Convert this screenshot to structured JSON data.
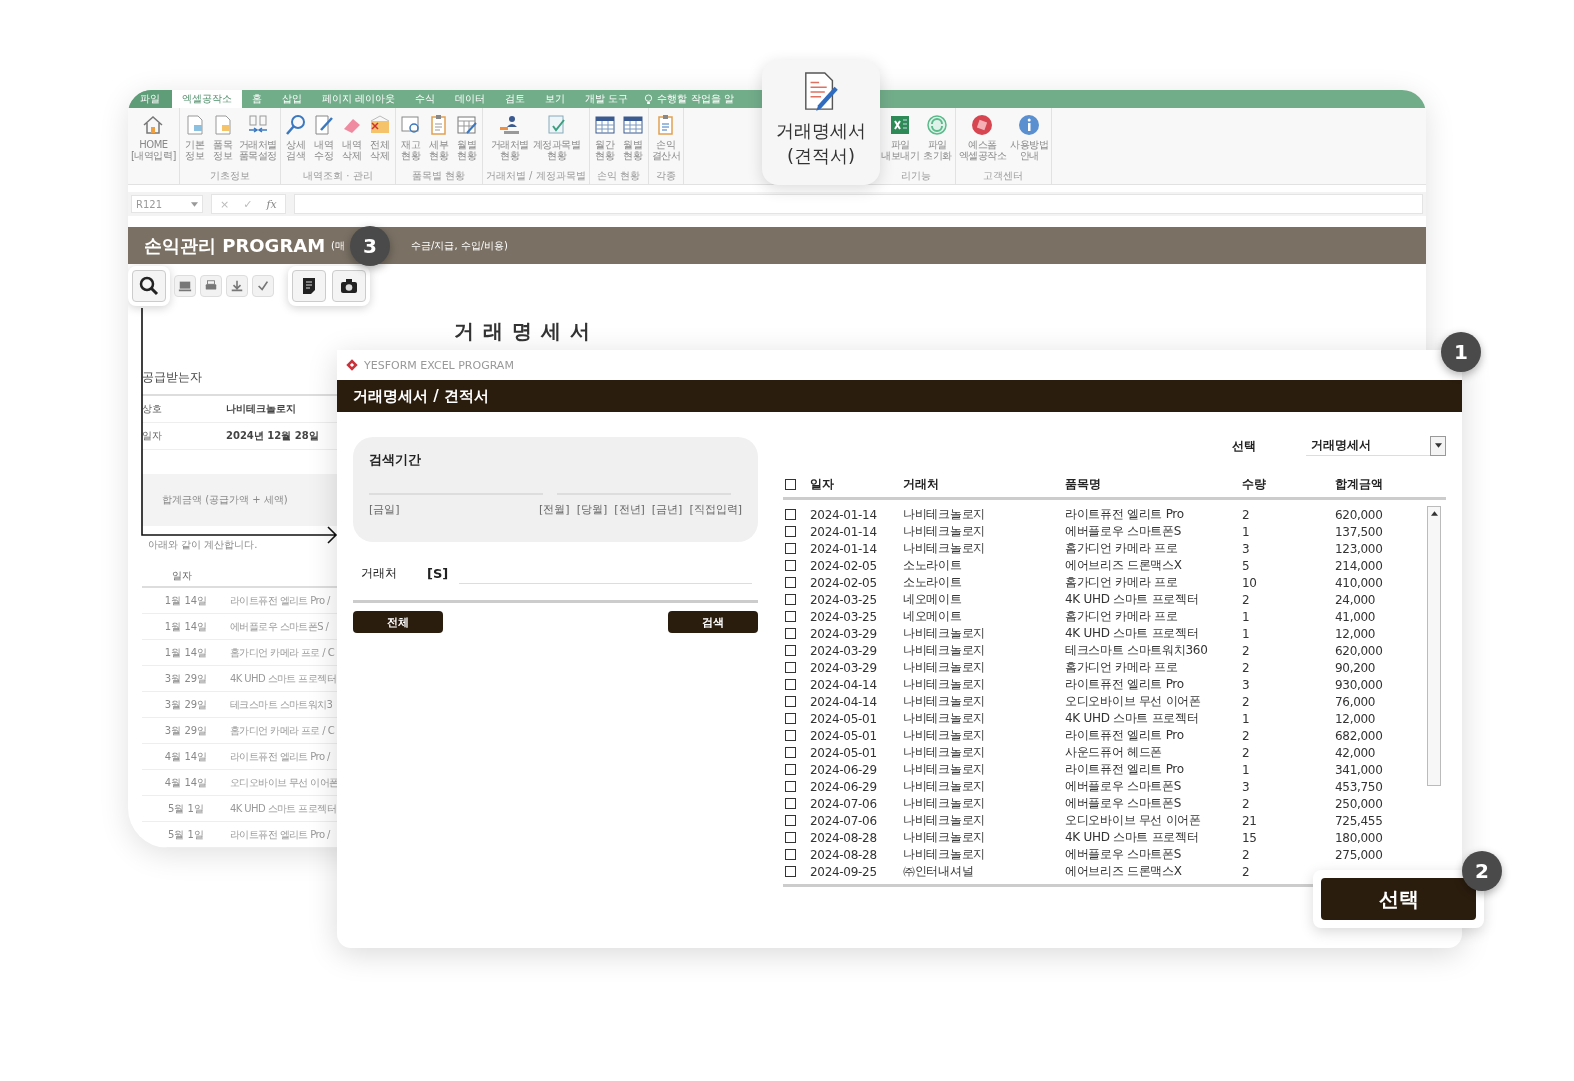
{
  "excel": {
    "tabs": [
      {
        "label": "파일",
        "selected": false,
        "kind": "file"
      },
      {
        "label": "엑셀공작소",
        "selected": true,
        "kind": "tab"
      },
      {
        "label": "홈",
        "selected": false,
        "kind": "tab"
      },
      {
        "label": "삽입",
        "selected": false,
        "kind": "tab"
      },
      {
        "label": "페이지 레이아웃",
        "selected": false,
        "kind": "tab"
      },
      {
        "label": "수식",
        "selected": false,
        "kind": "tab"
      },
      {
        "label": "데이터",
        "selected": false,
        "kind": "tab"
      },
      {
        "label": "검토",
        "selected": false,
        "kind": "tab"
      },
      {
        "label": "보기",
        "selected": false,
        "kind": "tab"
      },
      {
        "label": "개발 도구",
        "selected": false,
        "kind": "tab"
      },
      {
        "label": "수행할 작업을 알",
        "selected": false,
        "kind": "tell"
      }
    ],
    "ribbon_left": [
      {
        "items": [
          {
            "lines": [
              "HOME",
              "[내역입력]"
            ]
          }
        ]
      },
      {
        "label": "기초정보",
        "items": [
          {
            "lines": [
              "기본",
              "정보"
            ]
          },
          {
            "lines": [
              "품목",
              "정보"
            ]
          },
          {
            "lines": [
              "거래처별",
              "품목설정"
            ]
          }
        ]
      },
      {
        "label": "내역조회 · 관리",
        "items": [
          {
            "lines": [
              "상세",
              "검색"
            ]
          },
          {
            "lines": [
              "내역",
              "수정"
            ]
          },
          {
            "lines": [
              "내역",
              "삭제"
            ]
          },
          {
            "lines": [
              "전체",
              "삭제"
            ]
          }
        ]
      },
      {
        "label": "품목별 현황",
        "items": [
          {
            "lines": [
              "재고",
              "현황"
            ]
          },
          {
            "lines": [
              "세부",
              "현황"
            ]
          },
          {
            "lines": [
              "월별",
              "현황"
            ]
          }
        ]
      },
      {
        "label": "거래처별 / 계정과목별",
        "items": [
          {
            "lines": [
              "거래처별",
              "현황"
            ]
          },
          {
            "lines": [
              "계정과목별",
              "현황"
            ]
          }
        ]
      },
      {
        "label": "손익 현황",
        "items": [
          {
            "lines": [
              "월간",
              "현황"
            ]
          },
          {
            "lines": [
              "월별",
              "현황"
            ]
          }
        ]
      },
      {
        "label": "각종",
        "items": [
          {
            "lines": [
              "손익",
              "결산서"
            ]
          }
        ]
      }
    ],
    "ribbon_right": [
      {
        "label": "리기능",
        "items": [
          {
            "lines": [
              "파일",
              "내보내기"
            ]
          },
          {
            "lines": [
              "파일",
              "초기화"
            ]
          }
        ]
      },
      {
        "label": "고객센터",
        "items": [
          {
            "lines": [
              "예스폼",
              "엑셀공작소"
            ]
          },
          {
            "lines": [
              "사용방법",
              "안내"
            ]
          }
        ]
      }
    ],
    "featured": {
      "lines": [
        "거래명세서",
        "(견적서)"
      ]
    },
    "formula_bar": {
      "name_box": "R121",
      "buttons": [
        "×",
        "✓",
        "fx"
      ]
    },
    "header": {
      "title": "손익관리 PROGRAM",
      "subtitle_parts": [
        "(매",
        "수금/지급, 수입/비용)"
      ]
    },
    "document": {
      "heading": "거 래 명 세 서",
      "recipient_label": "공급받는자",
      "fields": [
        {
          "label": "상호",
          "value": "나비테크놀로지"
        },
        {
          "label": "일자",
          "value": "2024년 12월 28일"
        }
      ],
      "total_label": "합계금액 (공급가액 + 세액)",
      "note": "아래와 같이 계산합니다.",
      "column": "일자",
      "rows": [
        {
          "date": "1월 14일",
          "item": "라이트퓨전 엘리트 Pro /"
        },
        {
          "date": "1월 14일",
          "item": "에버플로우 스마트폰S /"
        },
        {
          "date": "1월 14일",
          "item": "홈가디언 카메라 프로 / C"
        },
        {
          "date": "3월 29일",
          "item": "4K UHD 스마트 프로젝터"
        },
        {
          "date": "3월 29일",
          "item": "테크스마트 스마트워치3"
        },
        {
          "date": "3월 29일",
          "item": "홈가디언 카메라 프로 / C"
        },
        {
          "date": "4월 14일",
          "item": "라이트퓨전 엘리트 Pro /"
        },
        {
          "date": "4월 14일",
          "item": "오디오바이브 무선 이어폰"
        },
        {
          "date": "5월 1일",
          "item": "4K UHD 스마트 프로젝터"
        },
        {
          "date": "5월 1일",
          "item": "라이트퓨전 엘리트 Pro /"
        }
      ]
    }
  },
  "dialog": {
    "brand": "YESFORM EXCEL PROGRAM",
    "title": "거래명세서 / 견적서",
    "period_label": "검색기간",
    "quick_ranges": [
      "[금일]",
      "[전월]",
      "[당월]",
      "[전년]",
      "[금년]",
      "[직접입력]"
    ],
    "vendor_label": "거래처",
    "vendor_shortcut": "[S]",
    "buttons": [
      "전체",
      "검색"
    ],
    "select_label": "선택",
    "select_value": "거래명세서",
    "table": {
      "header_checked": false,
      "columns": [
        "일자",
        "거래처",
        "품목명",
        "수량",
        "합계금액"
      ],
      "rows": [
        {
          "checked": false,
          "cells": [
            "2024-01-14",
            "나비테크놀로지",
            "라이트퓨전 엘리트 Pro",
            "2",
            "620,000"
          ]
        },
        {
          "checked": false,
          "cells": [
            "2024-01-14",
            "나비테크놀로지",
            "에버플로우 스마트폰S",
            "1",
            "137,500"
          ]
        },
        {
          "checked": false,
          "cells": [
            "2024-01-14",
            "나비테크놀로지",
            "홈가디언 카메라 프로",
            "3",
            "123,000"
          ]
        },
        {
          "checked": false,
          "cells": [
            "2024-02-05",
            "소노라이트",
            "에어브리즈 드론맥스X",
            "5",
            "214,000"
          ]
        },
        {
          "checked": false,
          "cells": [
            "2024-02-05",
            "소노라이트",
            "홈가디언 카메라 프로",
            "10",
            "410,000"
          ]
        },
        {
          "checked": false,
          "cells": [
            "2024-03-25",
            "네오메이트",
            "4K UHD 스마트 프로젝터",
            "2",
            "24,000"
          ]
        },
        {
          "checked": false,
          "cells": [
            "2024-03-25",
            "네오메이트",
            "홈가디언 카메라 프로",
            "1",
            "41,000"
          ]
        },
        {
          "checked": false,
          "cells": [
            "2024-03-29",
            "나비테크놀로지",
            "4K UHD 스마트 프로젝터",
            "1",
            "12,000"
          ]
        },
        {
          "checked": false,
          "cells": [
            "2024-03-29",
            "나비테크놀로지",
            "테크스마트 스마트워치360",
            "2",
            "620,000"
          ]
        },
        {
          "checked": false,
          "cells": [
            "2024-03-29",
            "나비테크놀로지",
            "홈가디언 카메라 프로",
            "2",
            "90,200"
          ]
        },
        {
          "checked": false,
          "cells": [
            "2024-04-14",
            "나비테크놀로지",
            "라이트퓨전 엘리트 Pro",
            "3",
            "930,000"
          ]
        },
        {
          "checked": false,
          "cells": [
            "2024-04-14",
            "나비테크놀로지",
            "오디오바이브 무선 이어폰",
            "2",
            "76,000"
          ]
        },
        {
          "checked": false,
          "cells": [
            "2024-05-01",
            "나비테크놀로지",
            "4K UHD 스마트 프로젝터",
            "1",
            "12,000"
          ]
        },
        {
          "checked": false,
          "cells": [
            "2024-05-01",
            "나비테크놀로지",
            "라이트퓨전 엘리트 Pro",
            "2",
            "682,000"
          ]
        },
        {
          "checked": false,
          "cells": [
            "2024-05-01",
            "나비테크놀로지",
            "사운드퓨어 헤드폰",
            "2",
            "42,000"
          ]
        },
        {
          "checked": false,
          "cells": [
            "2024-06-29",
            "나비테크놀로지",
            "라이트퓨전 엘리트 Pro",
            "1",
            "341,000"
          ]
        },
        {
          "checked": false,
          "cells": [
            "2024-06-29",
            "나비테크놀로지",
            "에버플로우 스마트폰S",
            "3",
            "453,750"
          ]
        },
        {
          "checked": false,
          "cells": [
            "2024-07-06",
            "나비테크놀로지",
            "에버플로우 스마트폰S",
            "2",
            "250,000"
          ]
        },
        {
          "checked": false,
          "cells": [
            "2024-07-06",
            "나비테크놀로지",
            "오디오바이브 무선 이어폰",
            "21",
            "725,455"
          ]
        },
        {
          "checked": false,
          "cells": [
            "2024-08-28",
            "나비테크놀로지",
            "4K UHD 스마트 프로젝터",
            "15",
            "180,000"
          ]
        },
        {
          "checked": false,
          "cells": [
            "2024-08-28",
            "나비테크놀로지",
            "에버플로우 스마트폰S",
            "2",
            "275,000"
          ]
        },
        {
          "checked": false,
          "cells": [
            "2024-09-25",
            "㈜인터내셔널",
            "에어브리즈 드론맥스X",
            "2"
          ]
        }
      ]
    },
    "confirm_button": "선택"
  },
  "callouts": [
    "1",
    "2",
    "3"
  ]
}
